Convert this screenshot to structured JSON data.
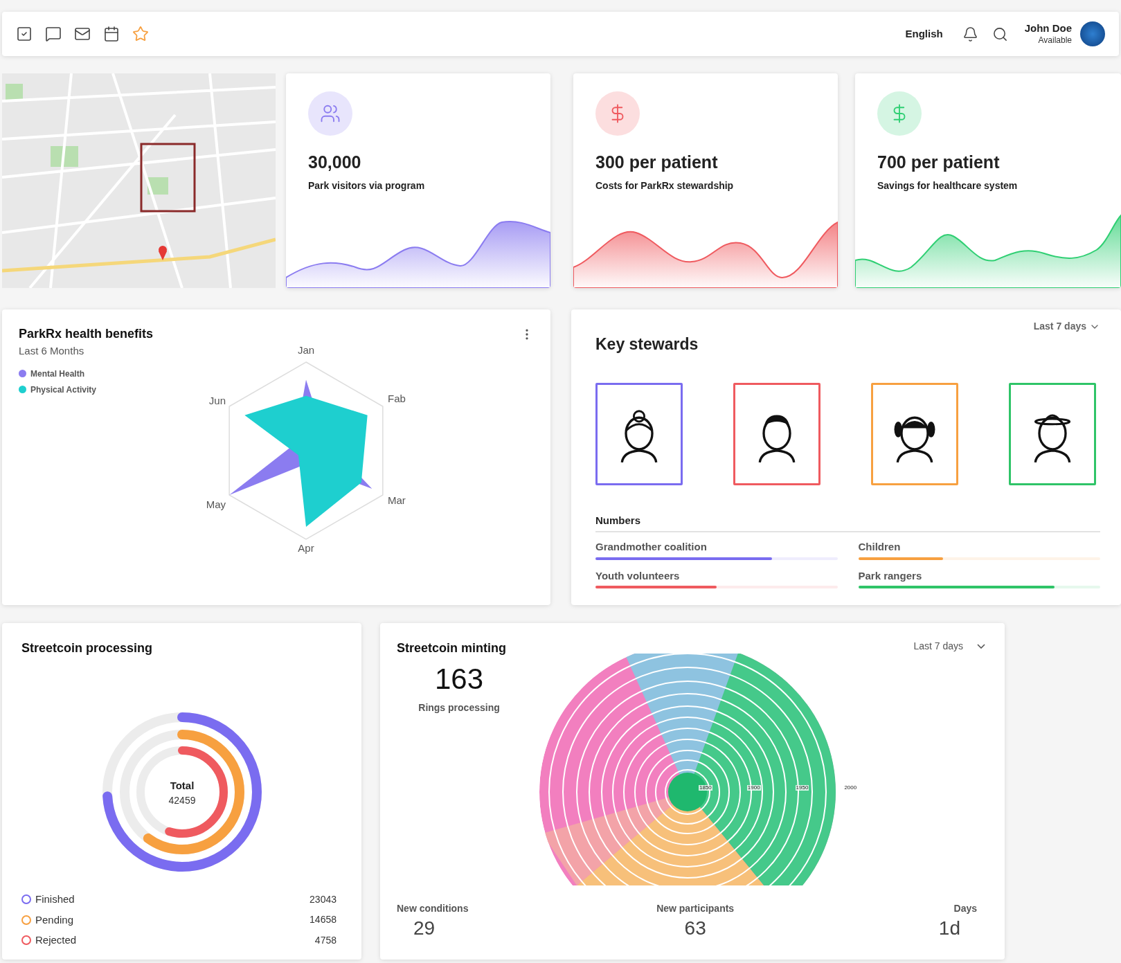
{
  "header": {
    "language": "English",
    "user": {
      "name": "John Doe",
      "status": "Available"
    }
  },
  "stats": [
    {
      "kind": "people",
      "value": "30,000",
      "label": "Park visitors via program",
      "color": "#8b7cf0"
    },
    {
      "kind": "dollar",
      "value": "300 per patient",
      "label": "Costs for ParkRx stewardship",
      "color": "#ef5a5f"
    },
    {
      "kind": "dollar",
      "value": "700 per patient",
      "label": "Savings for healthcare system",
      "color": "#2fcf73"
    }
  ],
  "health_benefits": {
    "title": "ParkRx health benefits",
    "subtitle": "Last 6 Months",
    "series": [
      {
        "name": "Mental Health",
        "color": "#8b7cf0"
      },
      {
        "name": "Physical Activity",
        "color": "#1ecfcf"
      }
    ],
    "axes": [
      "Jan",
      "Fab",
      "Mar",
      "Apr",
      "May",
      "Jun"
    ]
  },
  "key_stewards": {
    "title": "Key stewards",
    "period": "Last 7 days",
    "stewards": [
      {
        "kind": "grandmother",
        "color": "#7a6cf0"
      },
      {
        "kind": "man",
        "color": "#ef5a5f"
      },
      {
        "kind": "girl",
        "color": "#f7a040"
      },
      {
        "kind": "ranger",
        "color": "#2fc468"
      }
    ],
    "numbers_title": "Numbers",
    "numbers": [
      {
        "name": "Grandmother coalition",
        "color": "#7a6cf0",
        "level": 0.73
      },
      {
        "name": "Children",
        "color": "#f7a040",
        "level": 0.35
      },
      {
        "name": "Youth volunteers",
        "color": "#ef5a5f",
        "level": 0.5
      },
      {
        "name": "Park rangers",
        "color": "#2fc468",
        "level": 0.81
      }
    ]
  },
  "streetcoin_processing": {
    "title": "Streetcoin processing",
    "total_label": "Total",
    "total": "42459",
    "items": [
      {
        "name": "Finished",
        "value": "23043",
        "color": "#7a6cf0"
      },
      {
        "name": "Pending",
        "value": "14658",
        "color": "#f7a040"
      },
      {
        "name": "Rejected",
        "value": "4758",
        "color": "#ef5a5f"
      }
    ]
  },
  "streetcoin_minting": {
    "title": "Streetcoin minting",
    "period": "Last 7 days",
    "count": "163",
    "count_label": "Rings processing",
    "ring_labels": [
      "1850",
      "1900",
      "1950",
      "2000"
    ],
    "stats": [
      {
        "label": "New conditions",
        "value": "29"
      },
      {
        "label": "New participants",
        "value": "63"
      },
      {
        "label": "Days",
        "value": "1d"
      }
    ]
  }
}
